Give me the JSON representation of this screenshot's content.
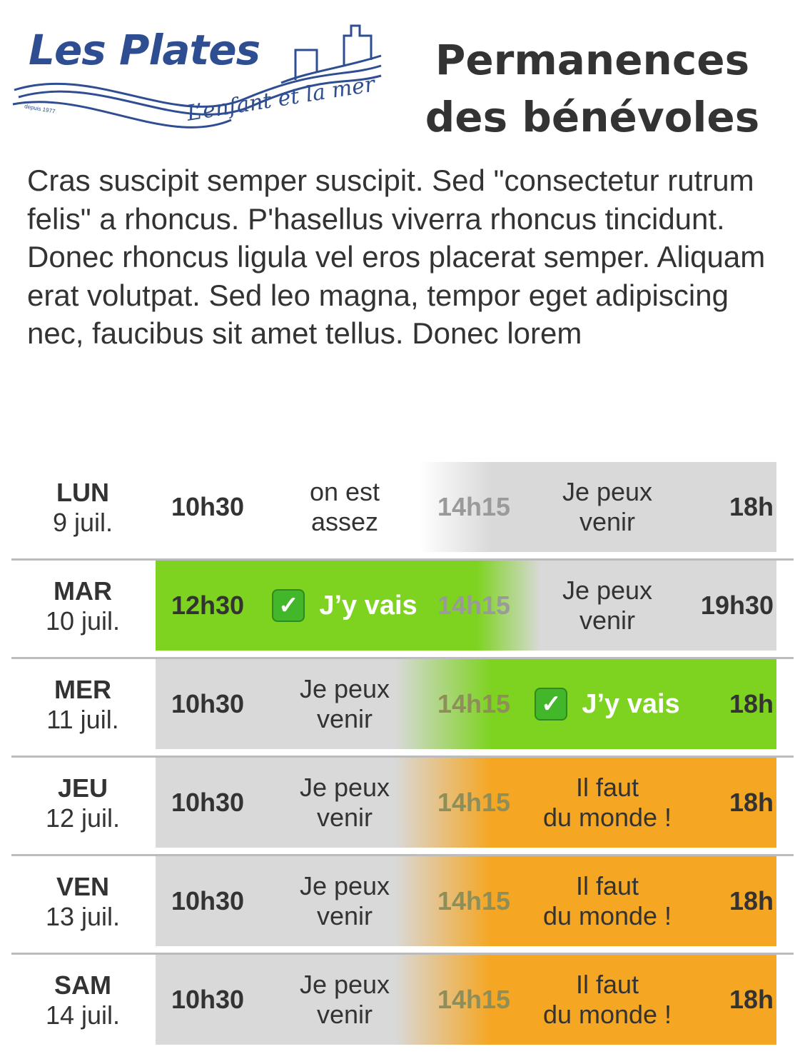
{
  "logo": {
    "name": "Les Plates",
    "tagline": "L’enfant et la mer",
    "since": "depuis 1977"
  },
  "title": {
    "line1": "Permanences",
    "line2": "des bénévoles"
  },
  "intro": "Cras suscipit semper suscipit. Sed \"consectetur rutrum felis\" a rhoncus. P'hasellus viverra rhoncus tincidunt. Donec rhoncus ligula vel eros placerat semper. Aliquam erat volutpat. Sed leo magna, tempor eget adipiscing nec, faucibus sit amet tellus. Donec lorem",
  "colors": {
    "grey": "#d9d9d9",
    "green": "#7ed321",
    "orange": "#f5a623",
    "white": "#ffffff",
    "brand_blue": "#2f4e91"
  },
  "schedule": [
    {
      "day": "LUN",
      "date": "9 juil.",
      "start": "10h30",
      "slot1": "on est\nassez",
      "slot1_state": "white",
      "mid": "14h15",
      "slot2": "Je peux\nvenir",
      "slot2_state": "grey",
      "end": "18h"
    },
    {
      "day": "MAR",
      "date": "10 juil.",
      "start": "12h30",
      "slot1": "J’y vais",
      "slot1_state": "green",
      "mid": "14h15",
      "slot2": "Je peux\nvenir",
      "slot2_state": "grey",
      "end": "19h30"
    },
    {
      "day": "MER",
      "date": "11 juil.",
      "start": "10h30",
      "slot1": "Je peux\nvenir",
      "slot1_state": "grey",
      "mid": "14h15",
      "slot2": "J’y vais",
      "slot2_state": "green",
      "end": "18h"
    },
    {
      "day": "JEU",
      "date": "12 juil.",
      "start": "10h30",
      "slot1": "Je peux\nvenir",
      "slot1_state": "grey",
      "mid": "14h15",
      "slot2": "Il faut\ndu monde !",
      "slot2_state": "orange",
      "end": "18h"
    },
    {
      "day": "VEN",
      "date": "13 juil.",
      "start": "10h30",
      "slot1": "Je peux\nvenir",
      "slot1_state": "grey",
      "mid": "14h15",
      "slot2": "Il faut\ndu monde !",
      "slot2_state": "orange",
      "end": "18h"
    },
    {
      "day": "SAM",
      "date": "14 juil.",
      "start": "10h30",
      "slot1": "Je peux\nvenir",
      "slot1_state": "grey",
      "mid": "14h15",
      "slot2": "Il faut\ndu monde !",
      "slot2_state": "orange",
      "end": "18h"
    }
  ]
}
